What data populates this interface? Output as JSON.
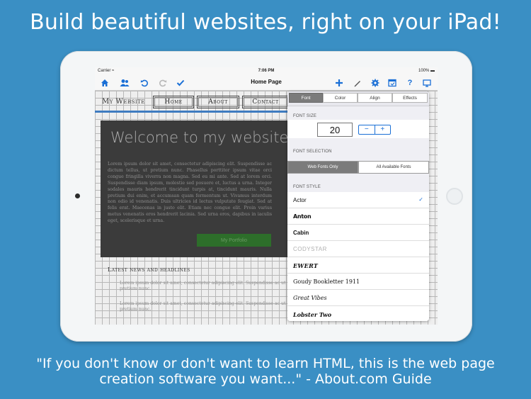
{
  "headline": "Build beautiful websites, right on your iPad!",
  "quote_line1": "\"If you don't know or don't want to learn HTML, this is the web page",
  "quote_line2": "creation software you want...\" - About.com Guide",
  "status": {
    "carrier": "Carrier ≈",
    "time": "7:06 PM",
    "battery": "100% ▬"
  },
  "toolbar": {
    "title": "Home Page",
    "icons_left": [
      "home-icon",
      "users-icon",
      "undo-icon",
      "redo-icon",
      "checkmark-icon"
    ],
    "icons_right": [
      "plus-icon",
      "pencil-icon",
      "gear-icon",
      "browser-icon",
      "help-icon",
      "preview-icon"
    ]
  },
  "site": {
    "title": "My Website",
    "nav": [
      "Home",
      "About",
      "Contact"
    ],
    "welcome": "Welcome to my website",
    "lorem": "Lorem ipsum dolor sit amet, consectetur adipiscing elit. Suspendisse ac dictum tellus, ut pretium nunc. Phasellus porttitor ipsum vitae orci congue fringilla viverra non magna. Sed eu mi ante. Sed at lorem orci. Suspendisse diam ipsum, molestie sed posuere et, luctus a urna. Integer sodales mauris hendrerit tincidunt turpis at, tincidunt mauris. Nulla pretium dui enim, et accumsan quam fermentum ut. Vivamus interdum non odio id venenatis. Duis ultricies id lectus vulputate feugiat. Sed at felis erat. Maecenas in justo elit. Etiam nec congue elit. Proin varius metus venenatis eros hendrerit lacinia. Sed urna eros, dapibus in iaculis eget, scelerisque et urna.",
    "portfolio_button": "My Portfolio",
    "news_title": "Latest news and headlines",
    "news_items": [
      "Lorem ipsum dolor sit amet, consectetur adipiscing elit. Suspendisse ac ut pretium nunc.",
      "Lorem ipsum dolor sit amet, consectetur adipiscing elit. Suspendisse ac ut pretium nunc."
    ]
  },
  "panel": {
    "tabs": [
      "Font",
      "Color",
      "Align",
      "Effects"
    ],
    "font_size_label": "FONT SIZE",
    "font_size": "20",
    "minus": "−",
    "plus": "+",
    "font_selection_label": "FONT SELECTION",
    "selection_options": [
      "Web Fonts Only",
      "All Available Fonts"
    ],
    "font_style_label": "FONT STYLE",
    "fonts": [
      "Actor",
      "Anton",
      "Cabin",
      "CODYSTAR",
      "EWERT",
      "Goudy Bookletter 1911",
      "Great Vibes",
      "Lobster Two"
    ],
    "selected_check": "✓"
  },
  "colors": {
    "accent": "#1a6fd6",
    "background": "#3a8fc4",
    "blue_rule": "#3f7cc0",
    "portfolio_green": "#2d6e2a"
  }
}
